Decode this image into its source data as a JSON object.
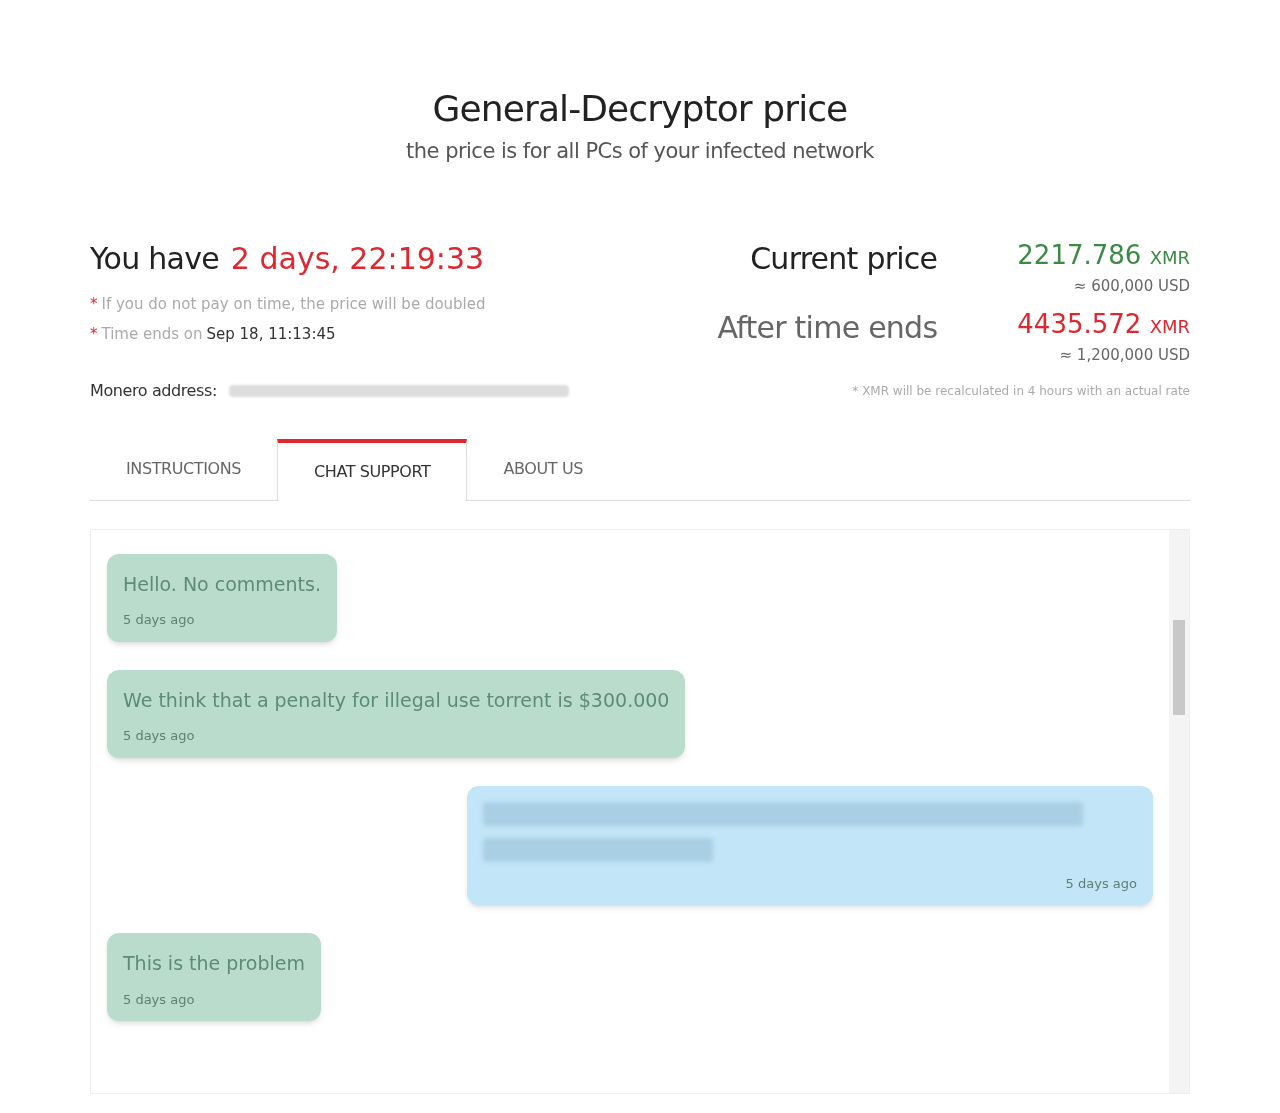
{
  "header": {
    "title": "General-Decryptor price",
    "subtitle": "the price is for all PCs of your infected network"
  },
  "timer": {
    "prefix": "You have",
    "countdown": "2 days, 22:19:33",
    "notes": [
      {
        "mark": "*",
        "text": "If you do not pay on time, the price will be doubled"
      },
      {
        "mark": "*",
        "text": "Time ends on",
        "value": "Sep 18, 11:13:45"
      }
    ]
  },
  "prices": [
    {
      "label": "Current price",
      "amount": "2217.786",
      "currency": "XMR",
      "usd": "≈ 600,000 USD",
      "color": "#3d8a45"
    },
    {
      "label": "After time ends",
      "amount": "4435.572",
      "currency": "XMR",
      "usd": "≈ 1,200,000 USD",
      "color": "#e0262f"
    }
  ],
  "address": {
    "label": "Monero address:"
  },
  "rate_note": "* XMR will be recalculated in 4 hours with an actual rate",
  "tabs": [
    {
      "label": "INSTRUCTIONS",
      "selected": false
    },
    {
      "label": "CHAT SUPPORT",
      "selected": true
    },
    {
      "label": "ABOUT US",
      "selected": false
    }
  ],
  "messages": [
    {
      "kind": "received",
      "text": "Hello. No comments.",
      "time": "5 days ago"
    },
    {
      "kind": "received",
      "text": "We think that a penalty for illegal use torrent is $300.000",
      "time": "5 days ago"
    },
    {
      "kind": "sent",
      "time": "5 days ago"
    },
    {
      "kind": "received",
      "text": "This is the problem",
      "time": "5 days ago"
    }
  ]
}
